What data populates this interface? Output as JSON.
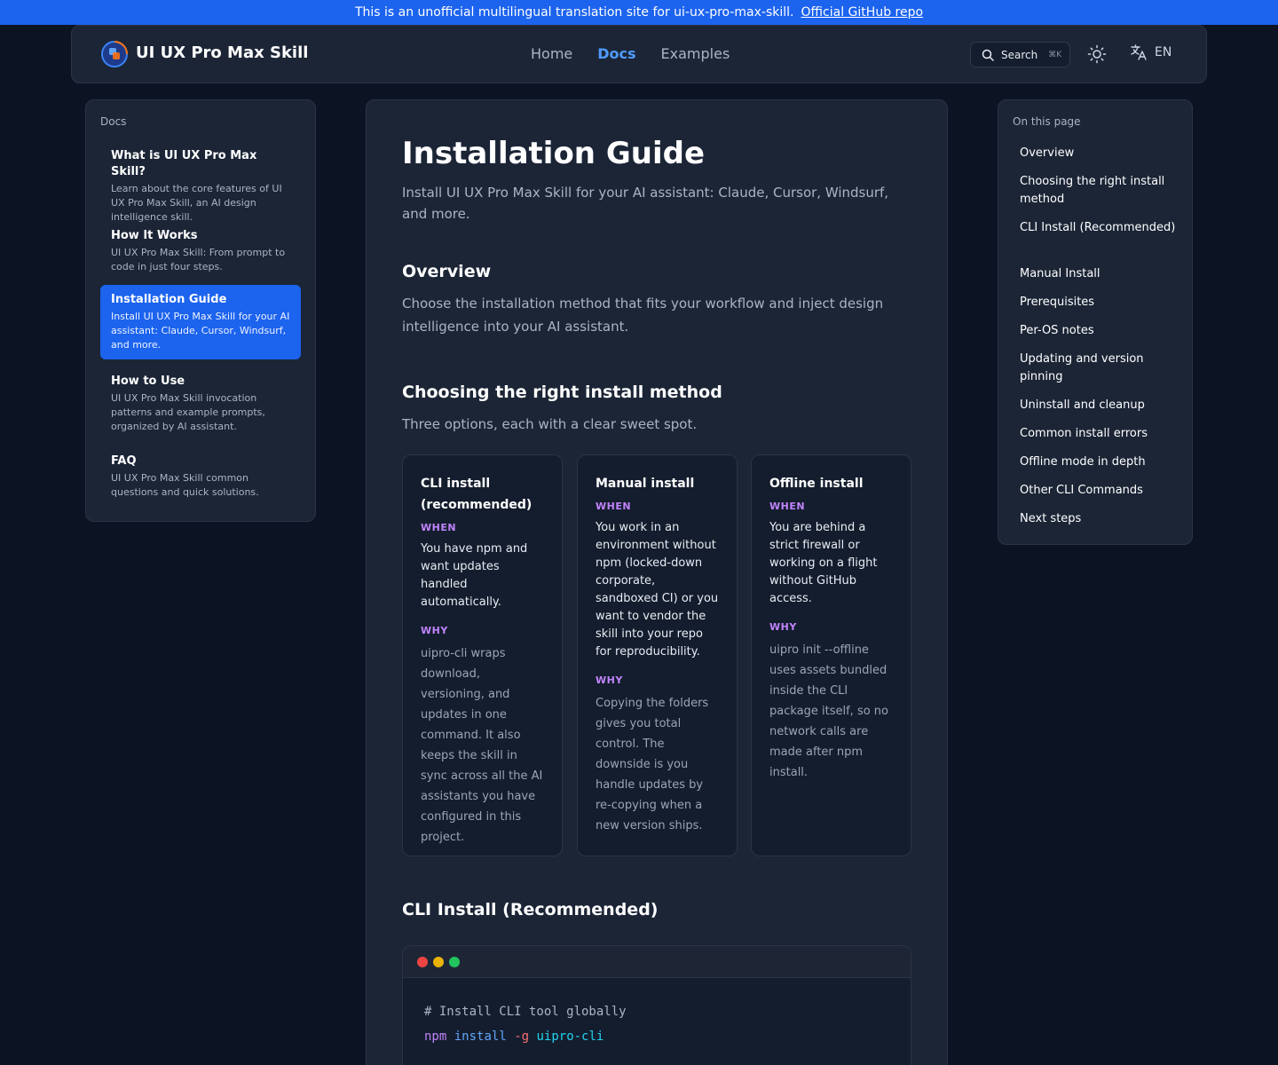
{
  "banner": {
    "text": "This is an unofficial multilingual translation site for ui-ux-pro-max-skill.",
    "link": "Official GitHub repo"
  },
  "header": {
    "brand": "UI UX Pro Max Skill",
    "nav": [
      "Home",
      "Docs",
      "Examples"
    ],
    "active_nav": "Docs",
    "search_label": "Search",
    "search_shortcut": "⌘K",
    "lang": "EN"
  },
  "sidebar": {
    "label": "Docs",
    "items": [
      {
        "title": "What is UI UX Pro Max Skill?",
        "desc": "Learn about the core features of UI UX Pro Max Skill, an AI design intelligence skill."
      },
      {
        "title": "How It Works",
        "desc": "UI UX Pro Max Skill: From prompt to code in just four steps."
      },
      {
        "title": "Installation Guide",
        "desc": "Install UI UX Pro Max Skill for your AI assistant: Claude, Cursor, Windsurf, and more."
      },
      {
        "title": "How to Use",
        "desc": "UI UX Pro Max Skill invocation patterns and example prompts, organized by AI assistant."
      },
      {
        "title": "FAQ",
        "desc": "UI UX Pro Max Skill common questions and quick solutions."
      }
    ]
  },
  "main": {
    "title": "Installation Guide",
    "lead": "Install UI UX Pro Max Skill for your AI assistant: Claude, Cursor, Windsurf, and more.",
    "overview": {
      "heading": "Overview",
      "text": "Choose the installation method that fits your workflow and inject design intelligence into your AI assistant."
    },
    "choosing": {
      "heading": "Choosing the right install method",
      "text": "Three options, each with a clear sweet spot."
    },
    "cards": [
      {
        "title": "CLI install (recommended)",
        "when_label": "WHEN",
        "when": "You have npm and want updates handled automatically.",
        "why_label": "WHY",
        "why": "uipro-cli wraps download, versioning, and updates in one command. It also keeps the skill in sync across all the AI assistants you have configured in this project."
      },
      {
        "title": "Manual install",
        "when_label": "WHEN",
        "when": "You work in an environment without npm (locked-down corporate, sandboxed CI) or you want to vendor the skill into your repo for reproducibility.",
        "why_label": "WHY",
        "why": "Copying the folders gives you total control. The downside is you handle updates by re-copying when a new version ships."
      },
      {
        "title": "Offline install",
        "when_label": "WHEN",
        "when": "You are behind a strict firewall or working on a flight without GitHub access.",
        "why_label": "WHY",
        "why": "uipro init --offline uses assets bundled inside the CLI package itself, so no network calls are made after npm install."
      }
    ],
    "cli": {
      "heading": "CLI Install (Recommended)",
      "comment": "# Install CLI tool globally",
      "cmd": "npm",
      "sub": "install",
      "flag": "-g",
      "pkg": "uipro-cli"
    }
  },
  "toc": {
    "label": "On this page",
    "items": [
      "Overview",
      "Choosing the right install method",
      "CLI Install (Recommended)",
      "Manual Install",
      "Prerequisites",
      "Per-OS notes",
      "Updating and version pinning",
      "Uninstall and cleanup",
      "Common install errors",
      "Offline mode in depth",
      "Other CLI Commands",
      "Next steps"
    ]
  },
  "colors": {
    "accent": "#1c63ee",
    "active_link": "#4f9cff",
    "label_purple": "#c084fc",
    "background": "#0c1424",
    "panel": "#1b2536"
  },
  "icons": [
    "logo-icon",
    "search-icon",
    "sun-icon",
    "translate-icon"
  ]
}
